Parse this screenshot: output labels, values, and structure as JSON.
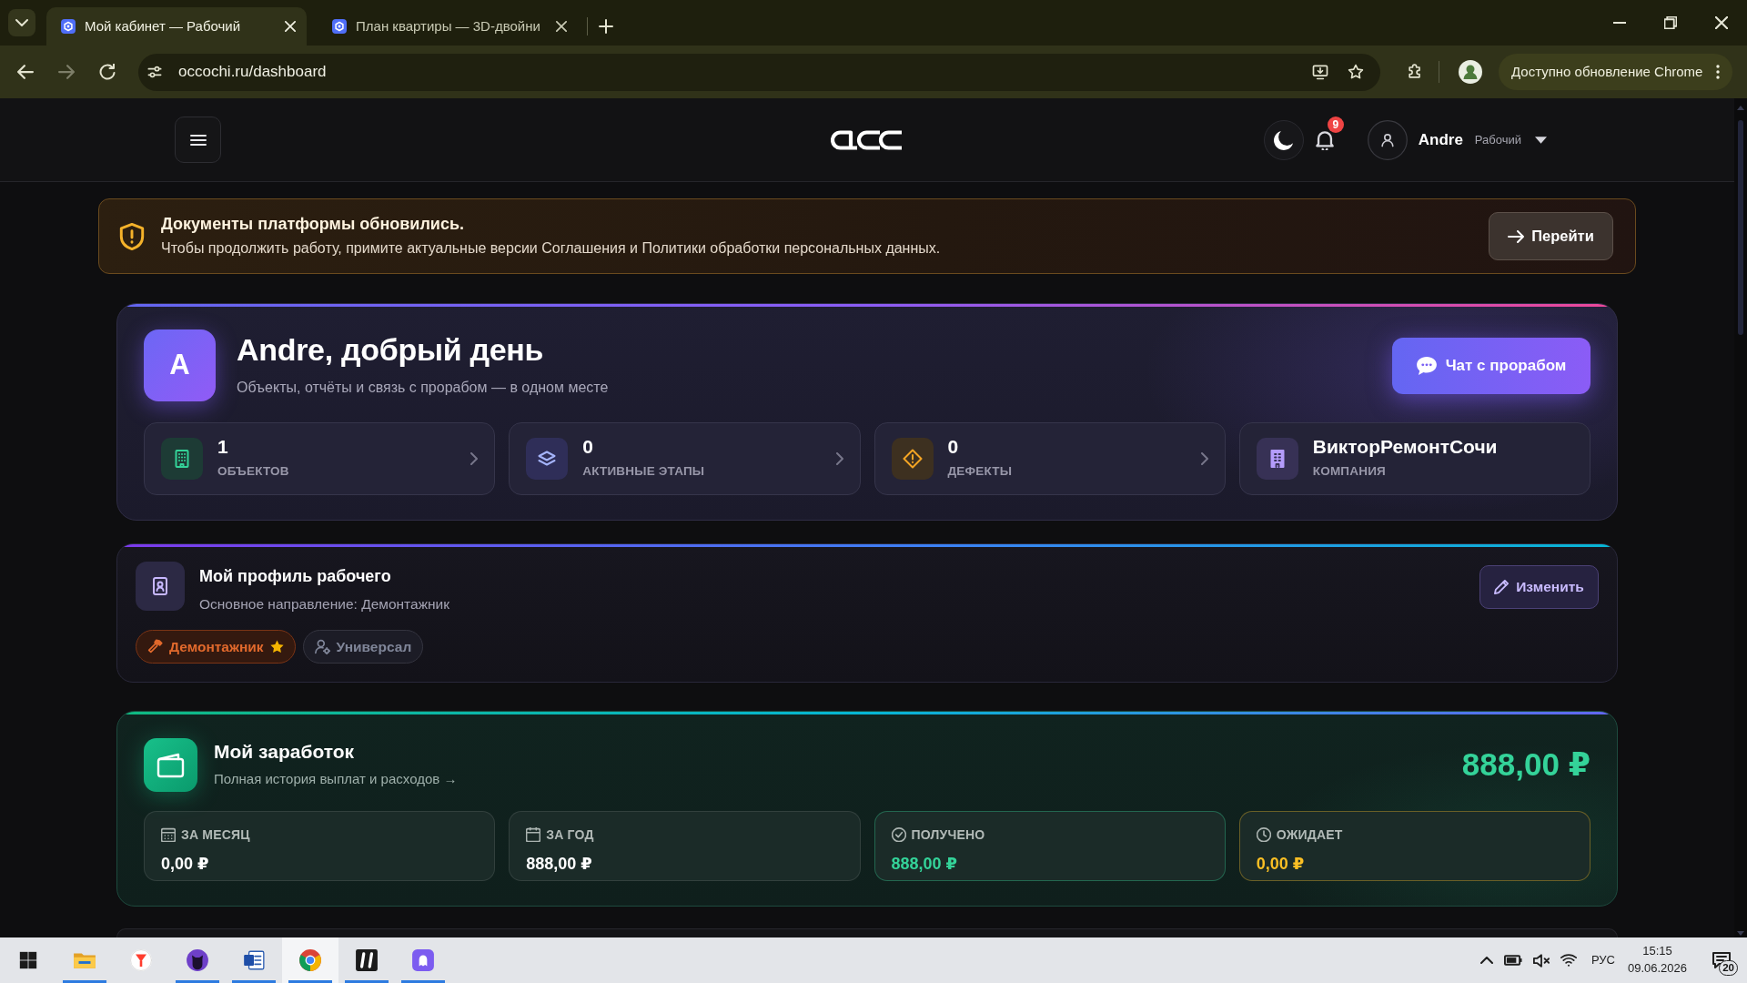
{
  "browser": {
    "tabs": [
      {
        "title": "Мой кабинет — Рабочий",
        "selected": true
      },
      {
        "title": "План квартиры — 3D-двойни",
        "selected": false
      }
    ],
    "nav_buttons": [
      {
        "kind": "back",
        "disabled": false
      },
      {
        "kind": "forward",
        "disabled": true
      },
      {
        "kind": "reload",
        "disabled": false
      }
    ],
    "address": "occochi.ru/dashboard",
    "update_button": "Доступно обновление Chrome"
  },
  "header": {
    "notifications": "9",
    "user_name": "Andre",
    "user_role": "Рабочий"
  },
  "notice": {
    "title": "Документы платформы обновились.",
    "text": "Чтобы продолжить работу, примите актуальные версии Соглашения и Политики обработки персональных данных.",
    "button": "Перейти"
  },
  "greeting": {
    "avatar": "A",
    "title": "Andre, добрый день",
    "subtitle": "Объекты, отчёты и связь с прорабом — в одном месте",
    "chat_button": "Чат с прорабом",
    "stats": [
      {
        "kind": "objects",
        "value": "1",
        "label": "ОБЪЕКТОВ",
        "link": true
      },
      {
        "kind": "stages",
        "value": "0",
        "label": "АКТИВНЫЕ ЭТАПЫ",
        "link": true
      },
      {
        "kind": "defects",
        "value": "0",
        "label": "ДЕФЕКТЫ",
        "link": true
      },
      {
        "kind": "company",
        "value": "ВикторРемонтСочи",
        "label": "КОМПАНИЯ",
        "link": false
      }
    ]
  },
  "profile": {
    "title": "Мой профиль рабочего",
    "subtitle": "Основное направление: Демонтажник",
    "edit_button": "Изменить",
    "tags": [
      {
        "kind": "main",
        "label": "Демонтажник",
        "starred": true
      },
      {
        "kind": "extra",
        "label": "Универсал",
        "starred": false
      }
    ]
  },
  "earnings": {
    "title": "Мой заработок",
    "history_link": "Полная история выплат и расходов →",
    "total": "888,00 ₽",
    "stats": [
      {
        "kind": "month",
        "label": "ЗА МЕСЯЦ",
        "value": "0,00 ₽",
        "color": "#ffffff"
      },
      {
        "kind": "year",
        "label": "ЗА ГОД",
        "value": "888,00 ₽",
        "color": "#ffffff"
      },
      {
        "kind": "received",
        "label": "ПОЛУЧЕНО",
        "value": "888,00 ₽",
        "color": "#34d399"
      },
      {
        "kind": "pending",
        "label": "ОЖИДАЕТ",
        "value": "0,00 ₽",
        "color": "#fbbf24"
      }
    ]
  },
  "taskbar": {
    "apps": [
      {
        "kind": "folder",
        "running": true,
        "selected": false
      },
      {
        "kind": "funnel",
        "running": false,
        "selected": false
      },
      {
        "kind": "cat",
        "running": true,
        "selected": false
      },
      {
        "kind": "document",
        "running": true,
        "selected": false
      },
      {
        "kind": "chrome",
        "running": true,
        "selected": true
      },
      {
        "kind": "slash",
        "running": true,
        "selected": false
      },
      {
        "kind": "ghost",
        "running": true,
        "selected": false
      }
    ],
    "language": "РУС",
    "time": "15:15",
    "date": "09.06.2026",
    "notifications": "20"
  }
}
